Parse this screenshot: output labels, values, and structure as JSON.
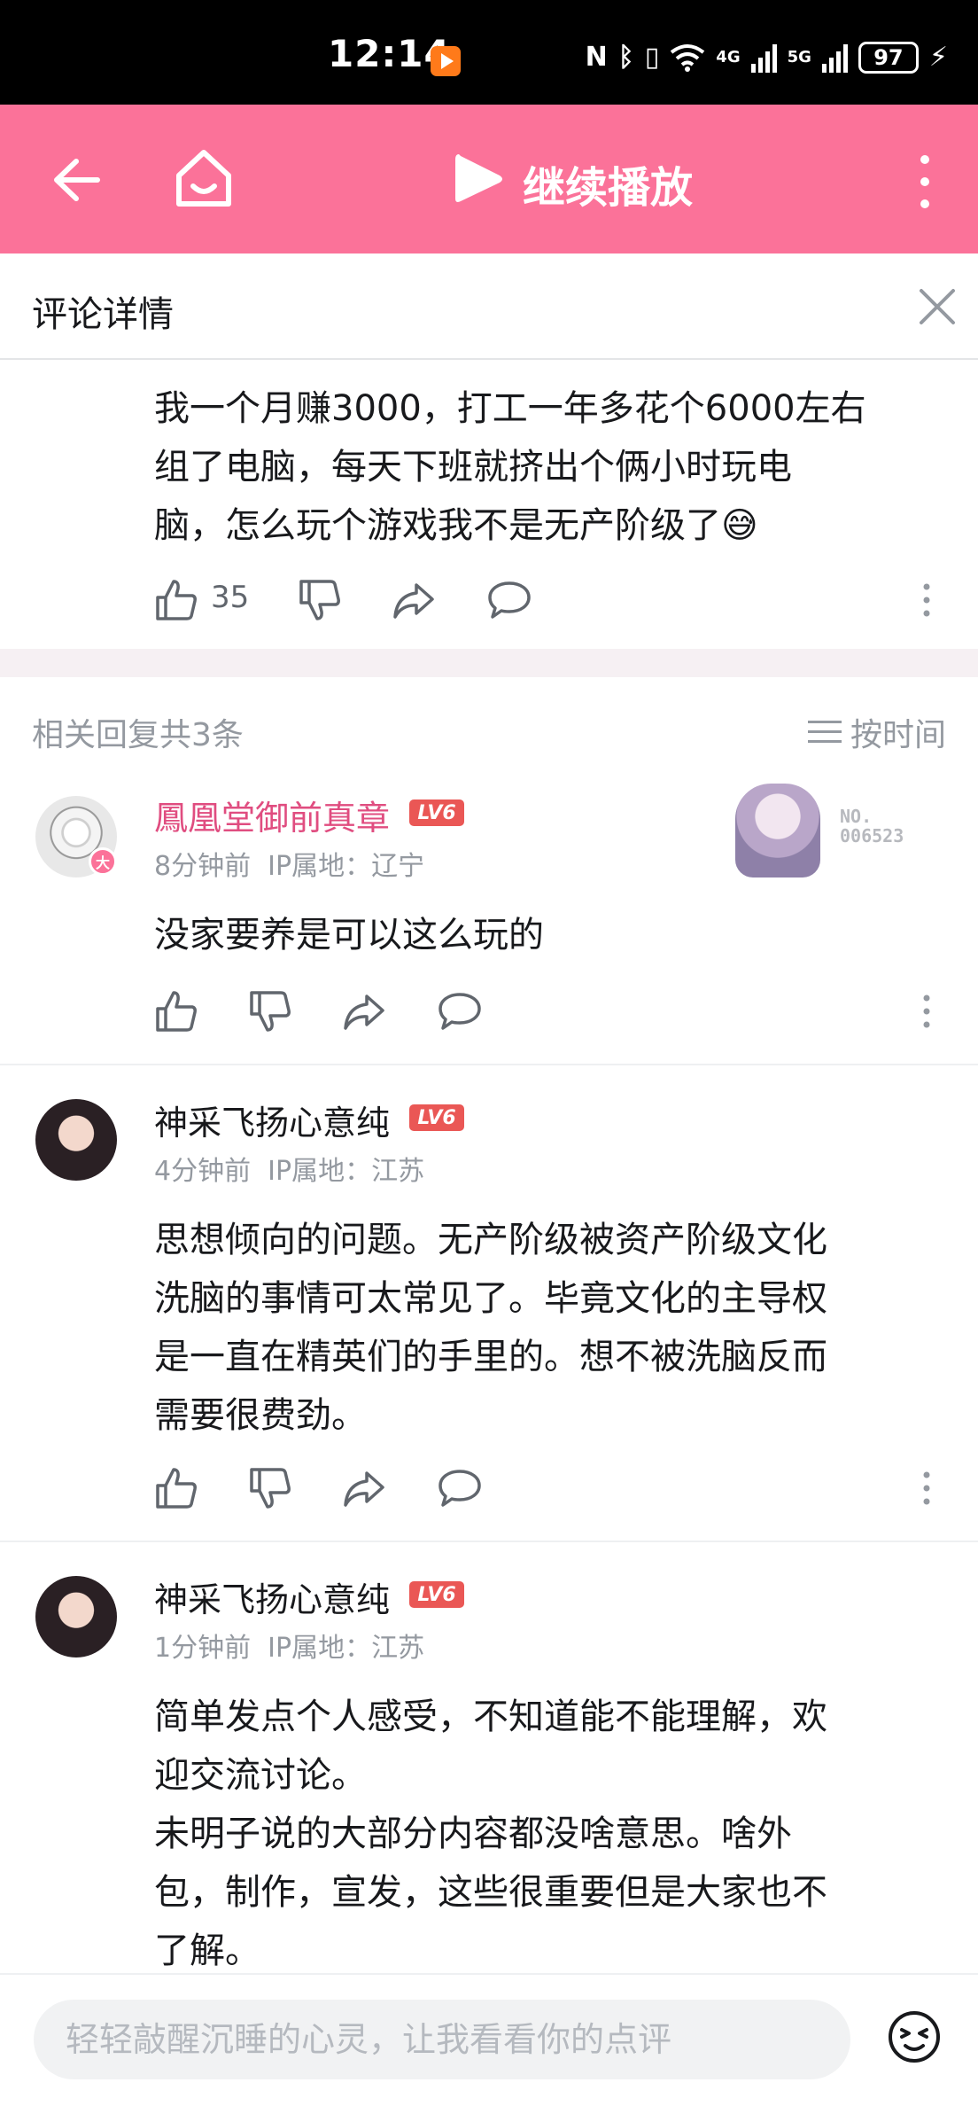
{
  "status_bar": {
    "time": "12:14",
    "network_4g": "4G",
    "network_5g": "5G",
    "battery": "97"
  },
  "header": {
    "title": "继续播放"
  },
  "detail": {
    "title": "评论详情"
  },
  "main_comment": {
    "text_lines": [
      "我一个月赚3000，打工一年多花个6000左右",
      "组了电脑，每天下班就挤出个俩小时玩电",
      "脑，怎么玩个游戏我不是无产阶级了😅"
    ],
    "like_count": "35"
  },
  "replies": {
    "header": "相关回复共3条",
    "sort_label": "按时间",
    "items": [
      {
        "username": "鳳凰堂御前真章",
        "level": "LV6",
        "time": "8分钟前",
        "ip": "IP属地：辽宁",
        "avatar_badge": "大",
        "fan_badge_line1": "NO.",
        "fan_badge_line2": "006523",
        "text_lines": [
          "没家要养是可以这么玩的"
        ]
      },
      {
        "username": "神采飞扬心意纯",
        "level": "LV6",
        "time": "4分钟前",
        "ip": "IP属地：江苏",
        "text_lines": [
          "思想倾向的问题。无产阶级被资产阶级文化",
          "洗脑的事情可太常见了。毕竟文化的主导权",
          "是一直在精英们的手里的。想不被洗脑反而",
          "需要很费劲。"
        ]
      },
      {
        "username": "神采飞扬心意纯",
        "level": "LV6",
        "time": "1分钟前",
        "ip": "IP属地：江苏",
        "text_lines": [
          "简单发点个人感受，不知道能不能理解，欢",
          "迎交流讨论。",
          "未明子说的大部分内容都没啥意思。啥外",
          "包，制作，宣发，这些很重要但是大家也不",
          "了解。"
        ]
      }
    ]
  },
  "input": {
    "placeholder": "轻轻敲醒沉睡的心灵，让我看看你的点评"
  },
  "colors": {
    "brand_pink": "#fb7299",
    "level_red": "#ea5755",
    "vip_name": "#e04d80"
  },
  "icons": [
    "back-arrow-icon",
    "home-icon",
    "play-icon",
    "more-vertical-icon",
    "close-icon",
    "thumb-up-icon",
    "thumb-down-icon",
    "share-icon",
    "comment-icon",
    "sort-icon",
    "emoji-icon"
  ]
}
